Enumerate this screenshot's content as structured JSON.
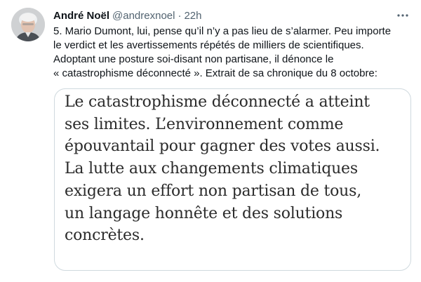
{
  "tweet": {
    "author": {
      "display_name": "André Noël",
      "handle": "@andrexnoel",
      "separator": "·",
      "timestamp": "22h"
    },
    "more_icon": "more-horizontal-icon",
    "text_lines": [
      "5. Mario Dumont, lui, pense qu’il n’y a pas lieu de s’alarmer. Peu importe",
      "le verdict et les avertissements répétés de milliers de scientifiques.",
      "Adoptant une posture soi-disant non partisane, il dénonce le",
      "« catastrophisme déconnecté ». Extrait de sa chronique du 8 octobre:"
    ],
    "media": {
      "quote_lines": [
        "Le catastrophisme déconnecté a atteint",
        "ses limites. L’environnement comme",
        "épouvantail pour gagner des votes aussi.",
        "La lutte aux changements climatiques",
        "exigera un effort non partisan de tous,",
        "un langage honnête et des solutions",
        "concrètes."
      ]
    }
  },
  "colors": {
    "text_primary": "#0f1419",
    "text_secondary": "#536471",
    "border": "#cfd9de",
    "quote_text": "#2b2b2b"
  }
}
